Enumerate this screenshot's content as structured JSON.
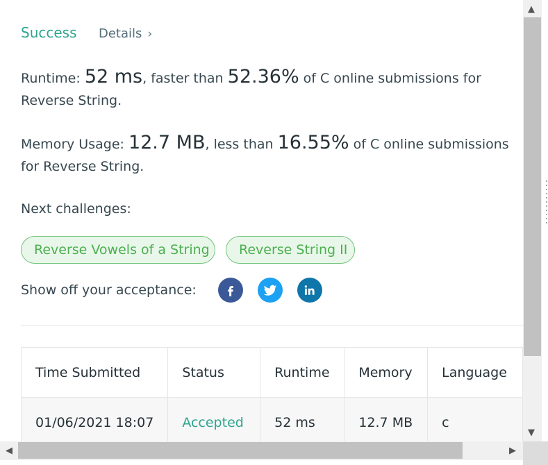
{
  "result": {
    "status": "Success",
    "details": "Details",
    "details_chevron": "›"
  },
  "runtime": {
    "label": "Runtime: ",
    "value": "52 ms",
    "mid": ", faster than ",
    "percent": "52.36%",
    "tail": " of C online submissions for Reverse String."
  },
  "memory": {
    "label": "Memory Usage: ",
    "value": "12.7 MB",
    "mid": ", less than ",
    "percent": "16.55%",
    "tail": " of C online submissions for Reverse String."
  },
  "next": {
    "label": "Next challenges:",
    "items": [
      "Reverse Vowels of a String",
      "Reverse String II"
    ]
  },
  "share": {
    "label": "Show off your acceptance:",
    "icons": [
      "facebook-icon",
      "twitter-icon",
      "linkedin-icon"
    ]
  },
  "table": {
    "headers": [
      "Time Submitted",
      "Status",
      "Runtime",
      "Memory",
      "Language"
    ],
    "rows": [
      [
        "01/06/2021 18:07",
        "Accepted",
        "52 ms",
        "12.7 MB",
        "c"
      ]
    ]
  },
  "colors": {
    "success": "#2fa58f",
    "chip_text": "#4caf50",
    "chip_bg": "#e9f7ea",
    "facebook": "#3b5998",
    "twitter": "#1da1f2",
    "linkedin": "#0e76a8"
  },
  "scrollbars": {
    "up": "▲",
    "down": "▼",
    "left": "◀",
    "right": "▶"
  }
}
